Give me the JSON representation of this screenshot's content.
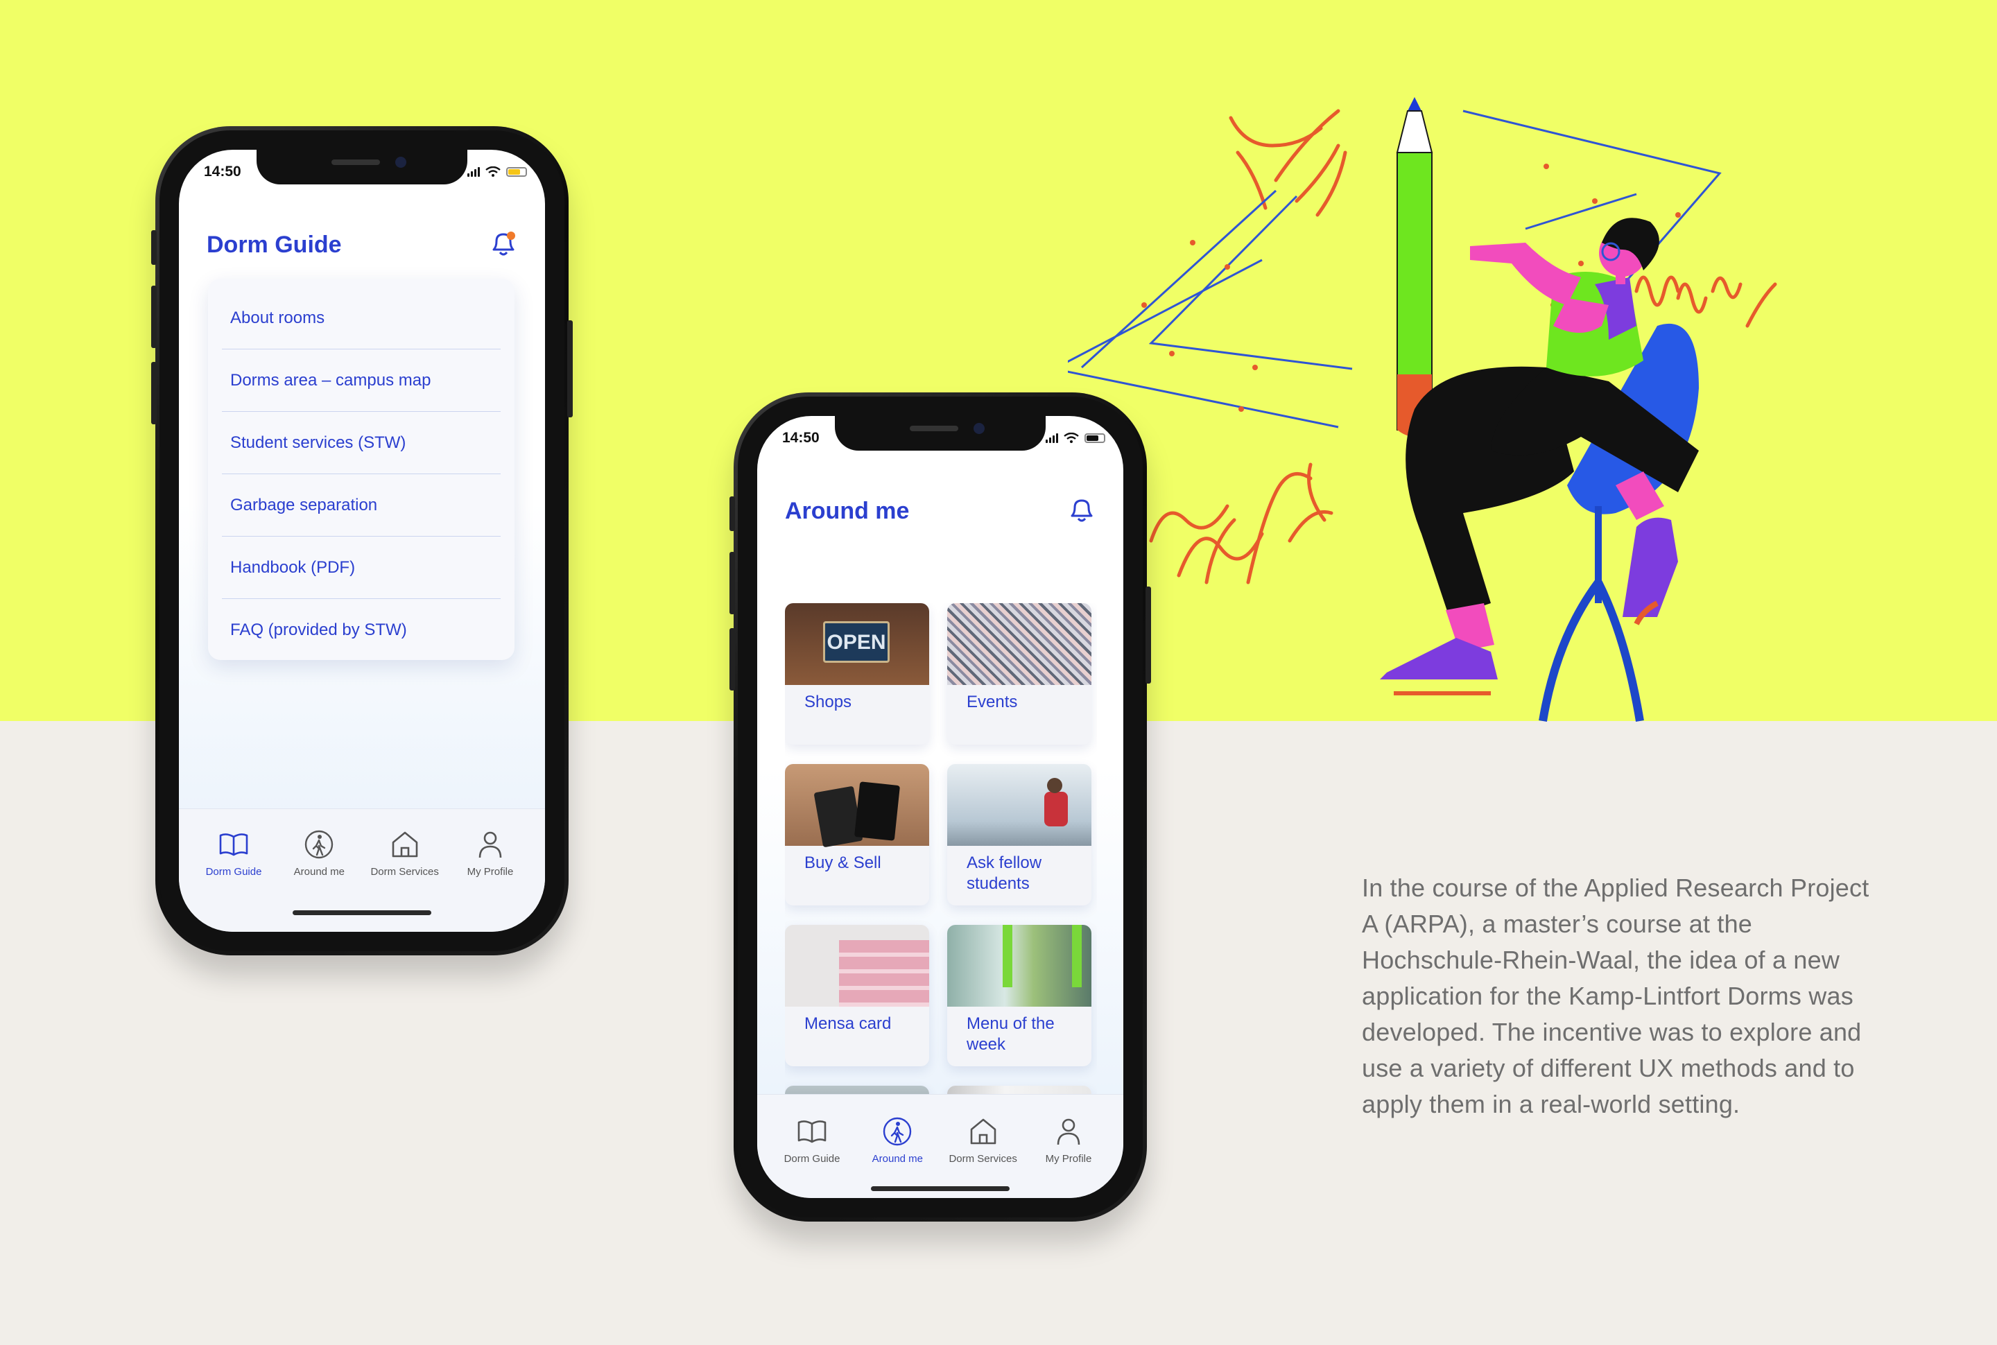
{
  "phone1": {
    "status_time": "14:50",
    "title": "Dorm Guide",
    "menu": [
      "About rooms",
      "Dorms area – campus map",
      "Student services (STW)",
      "Garbage separation",
      "Handbook (PDF)",
      "FAQ (provided by STW)"
    ],
    "tabs": [
      "Dorm Guide",
      "Around me",
      "Dorm Services",
      "My Profile"
    ],
    "active_tab": "Dorm Guide"
  },
  "phone2": {
    "status_time": "14:50",
    "title": "Around me",
    "tiles": [
      {
        "label": "Shops",
        "image": "open-shop-sign"
      },
      {
        "label": "Events",
        "image": "confetti-crowd"
      },
      {
        "label": "Buy & Sell",
        "image": "buy-sell-cards"
      },
      {
        "label": "Ask fellow students",
        "image": "student-backpack"
      },
      {
        "label": "Mensa card",
        "image": "pink-card"
      },
      {
        "label": "Menu of the week",
        "image": "cafeteria"
      },
      {
        "label": "",
        "image": "police-officers"
      },
      {
        "label": "",
        "image": "doctor"
      }
    ],
    "tabs": [
      "Dorm Guide",
      "Around me",
      "Dorm Services",
      "My Profile"
    ],
    "active_tab": "Around me"
  },
  "description": "In the course of the Applied Research Project A (ARPA), a master’s course at the Hochschule-Rhein-Waal, the idea of a new application for the Kamp-Lintfort Dorms was developed. The incentive was to explore and use a variety of different UX methods and to apply them in a real-world setting.",
  "colors": {
    "accent": "#2b3fcf",
    "top_background": "#f0ff66",
    "bottom_background": "#f1eee9",
    "notification_dot": "#f07a2a"
  },
  "icons": [
    "bell-icon",
    "book-icon",
    "walking-person-icon",
    "house-icon",
    "person-icon"
  ]
}
